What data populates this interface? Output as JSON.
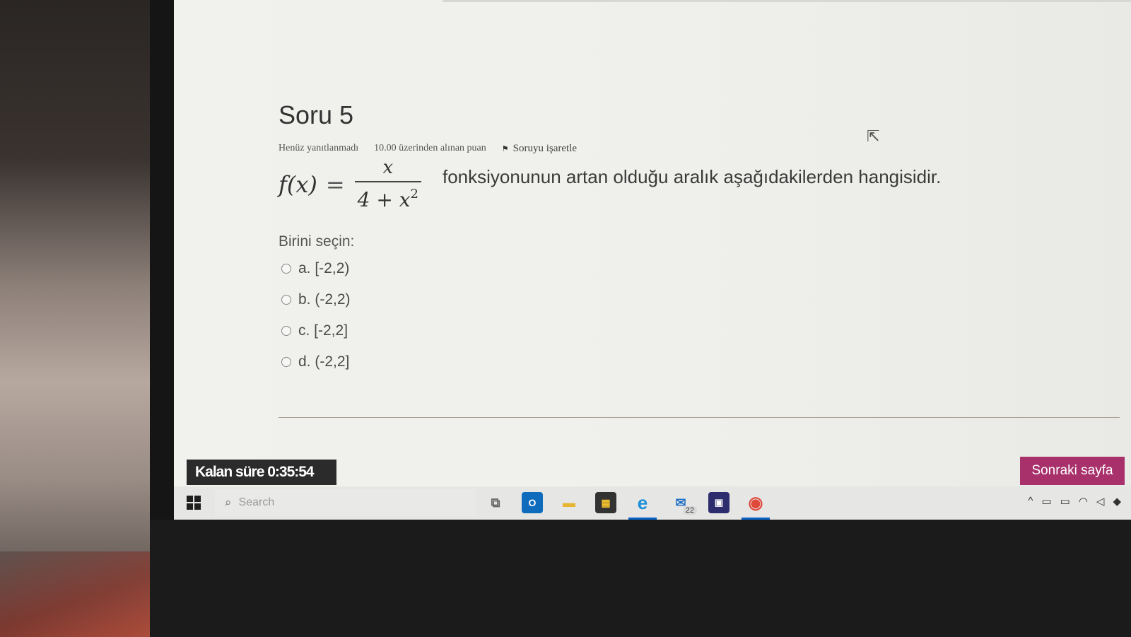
{
  "question": {
    "title": "Soru 5",
    "status": "Henüz yanıtlanmadı",
    "points": "10.00 üzerinden alınan puan",
    "flag_label": "Soruyu işaretle",
    "formula_lhs": "f(x)",
    "formula_eq": "=",
    "formula_num": "x",
    "formula_den_base": "4 + x",
    "formula_den_exp": "2",
    "text": "fonksiyonunun artan olduğu aralık  aşağıdakilerden hangisidir.",
    "choose_label": "Birini seçin:",
    "options": [
      {
        "label": "a. [-2,2)"
      },
      {
        "label": "b. (-2,2)"
      },
      {
        "label": "c. [-2,2]"
      },
      {
        "label": "d. (-2,2]"
      }
    ]
  },
  "footer": {
    "timer": "Kalan süre 0:35:54",
    "next_button": "Sonraki sayfa"
  },
  "taskbar": {
    "search_placeholder": "Search",
    "mail_badge": "22",
    "apps": [
      "task-view-icon",
      "outlook-icon",
      "file-explorer-icon",
      "store-icon",
      "edge-icon",
      "mail-icon",
      "app-icon",
      "chrome-icon"
    ]
  },
  "colors": {
    "next_button_bg": "#a8306b",
    "timer_bg": "#2b2b2b"
  }
}
